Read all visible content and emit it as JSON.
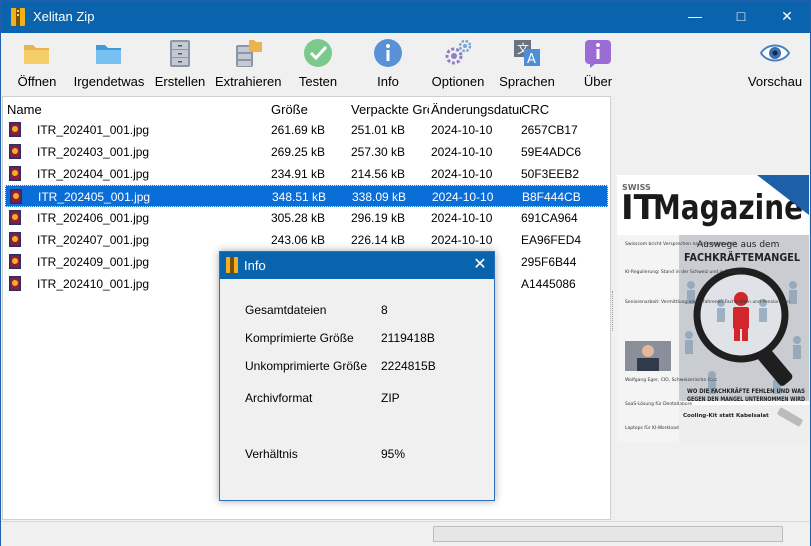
{
  "window": {
    "title": "Xelitan Zip",
    "min_glyph": "—",
    "max_glyph": "□",
    "close_glyph": "✕"
  },
  "toolbar": [
    {
      "label": "Öffnen",
      "icon": "folder-open-icon"
    },
    {
      "label": "Irgendetwas",
      "icon": "folder-icon"
    },
    {
      "label": "Erstellen",
      "icon": "cabinet-icon"
    },
    {
      "label": "Extrahieren",
      "icon": "extract-icon"
    },
    {
      "label": "Testen",
      "icon": "check-icon"
    },
    {
      "label": "Info",
      "icon": "info-icon"
    },
    {
      "label": "Optionen",
      "icon": "gears-icon"
    },
    {
      "label": "Sprachen",
      "icon": "language-icon"
    },
    {
      "label": "Über",
      "icon": "about-icon"
    },
    {
      "label": "Vorschau",
      "icon": "eye-icon"
    }
  ],
  "columns": [
    "Name",
    "Größe",
    "Verpackte Größe",
    "Änderungsdatum",
    "CRC"
  ],
  "files": [
    {
      "name": "ITR_202401_001.jpg",
      "size": "261.69 kB",
      "packed": "251.01 kB",
      "date": "2024-10-10",
      "crc": "2657CB17"
    },
    {
      "name": "ITR_202403_001.jpg",
      "size": "269.25 kB",
      "packed": "257.30 kB",
      "date": "2024-10-10",
      "crc": "59E4ADC6"
    },
    {
      "name": "ITR_202404_001.jpg",
      "size": "234.91 kB",
      "packed": "214.56 kB",
      "date": "2024-10-10",
      "crc": "50F3EEB2"
    },
    {
      "name": "ITR_202405_001.jpg",
      "size": "348.51 kB",
      "packed": "338.09 kB",
      "date": "2024-10-10",
      "crc": "B8F444CB",
      "selected": true
    },
    {
      "name": "ITR_202406_001.jpg",
      "size": "305.28 kB",
      "packed": "296.19 kB",
      "date": "2024-10-10",
      "crc": "691CA964"
    },
    {
      "name": "ITR_202407_001.jpg",
      "size": "243.06 kB",
      "packed": "226.14 kB",
      "date": "2024-10-10",
      "crc": "EA96FED4"
    },
    {
      "name": "ITR_202409_001.jpg",
      "size": "",
      "packed": "",
      "date": "",
      "crc": "295F6B44"
    },
    {
      "name": "ITR_202410_001.jpg",
      "size": "",
      "packed": "",
      "date": "",
      "crc": "A1445086"
    }
  ],
  "dialog": {
    "title": "Info",
    "close_glyph": "✕",
    "rows": [
      {
        "key": "Gesamtdateien",
        "value": "8"
      },
      {
        "key": "Komprimierte Größe",
        "value": "2119418B"
      },
      {
        "key": "Unkomprimierte Größe",
        "value": "2224815B"
      },
      {
        "key": "Archivformat",
        "value": "ZIP"
      },
      {
        "key": "Verhältnis",
        "value": "95%"
      }
    ]
  },
  "preview": {
    "brand_small": "SWISS",
    "brand_it": "IT",
    "brand_magazine": "Magazine",
    "headline_1": "Auswege aus dem",
    "headline_2": "FACHKRÄFTEMANGEL",
    "bottom_1": "WO DIE FACHKRÄFTE FEHLEN UND WAS",
    "bottom_2": "GEGEN DEN MANGEL UNTERNOMMEN WIRD",
    "side_items": [
      "Swisscom bricht Versprechen nach Pressicherheit",
      "KI-Regulierung: Stand in der Schweiz und in Europa",
      "Seniorenarbeit: Vermittlung von erfahrenen Fachkräften und Pensionären",
      "Wolfgang Eger, CIO, Schweizerische Post",
      "SaaS-Lösung für Dentallabore",
      "Laptops für KI-Workloads"
    ],
    "footer_title": "Cooling-Kit statt Kabelsalat"
  },
  "colors": {
    "titlebar": "#0a64ad",
    "selection": "#0a6ed8",
    "magazine_blue": "#1d5fa8",
    "magazine_red": "#d3262b"
  }
}
